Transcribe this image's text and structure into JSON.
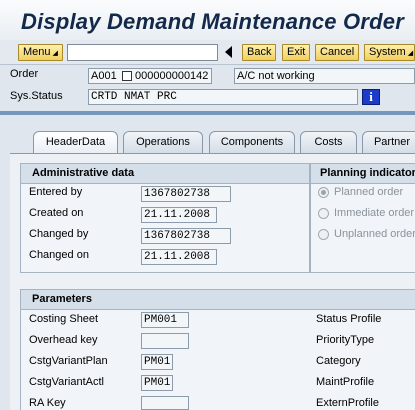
{
  "window": {
    "title": "Display Demand Maintenance Order"
  },
  "toolbar": {
    "menu_label": "Menu",
    "command_value": "",
    "back_label": "Back",
    "exit_label": "Exit",
    "cancel_label": "Cancel",
    "system_label": "System"
  },
  "header": {
    "order_label": "Order",
    "order_value": "A001 000000000142",
    "order_type_prefix": "A001",
    "order_number": "000000000142",
    "order_description": "A/C not working",
    "status_label": "Sys.Status",
    "status_value": "CRTD  NMAT  PRC",
    "info_icon": "info-icon"
  },
  "tabs": [
    {
      "label": "HeaderData",
      "active": true
    },
    {
      "label": "Operations",
      "active": false
    },
    {
      "label": "Components",
      "active": false
    },
    {
      "label": "Costs",
      "active": false
    },
    {
      "label": "Partner",
      "active": false
    }
  ],
  "admin": {
    "title": "Administrative data",
    "entered_by_label": "Entered by",
    "entered_by_value": "1367802738",
    "created_on_label": "Created on",
    "created_on_value": "21.11.2008",
    "changed_by_label": "Changed by",
    "changed_by_value": "1367802738",
    "changed_on_label": "Changed on",
    "changed_on_value": "21.11.2008"
  },
  "planning": {
    "title": "Planning indicator",
    "options": [
      "Planned order",
      "Immediate order",
      "Unplanned order"
    ],
    "selected": "Planned order"
  },
  "params": {
    "title": "Parameters",
    "costing_sheet_label": "Costing Sheet",
    "costing_sheet_value": "PM001",
    "overhead_key_label": "Overhead key",
    "overhead_key_value": "",
    "cstg_variant_plan_label": "CstgVariantPlan",
    "cstg_variant_plan_value": "PM01",
    "cstg_variant_actl_label": "CstgVariantActl",
    "cstg_variant_actl_value": "PM01",
    "ra_key_label": "RA Key",
    "ra_key_value": "",
    "status_profile_label": "Status Profile",
    "priority_type_label": "PriorityType",
    "category_label": "Category",
    "maint_profile_label": "MaintProfile",
    "extern_profile_label": "ExternProfile"
  },
  "colors": {
    "title": "#13294a",
    "button_fill": "#f2cf5e",
    "info_button": "#1a3cc8",
    "group_header": "#d5dfea"
  }
}
